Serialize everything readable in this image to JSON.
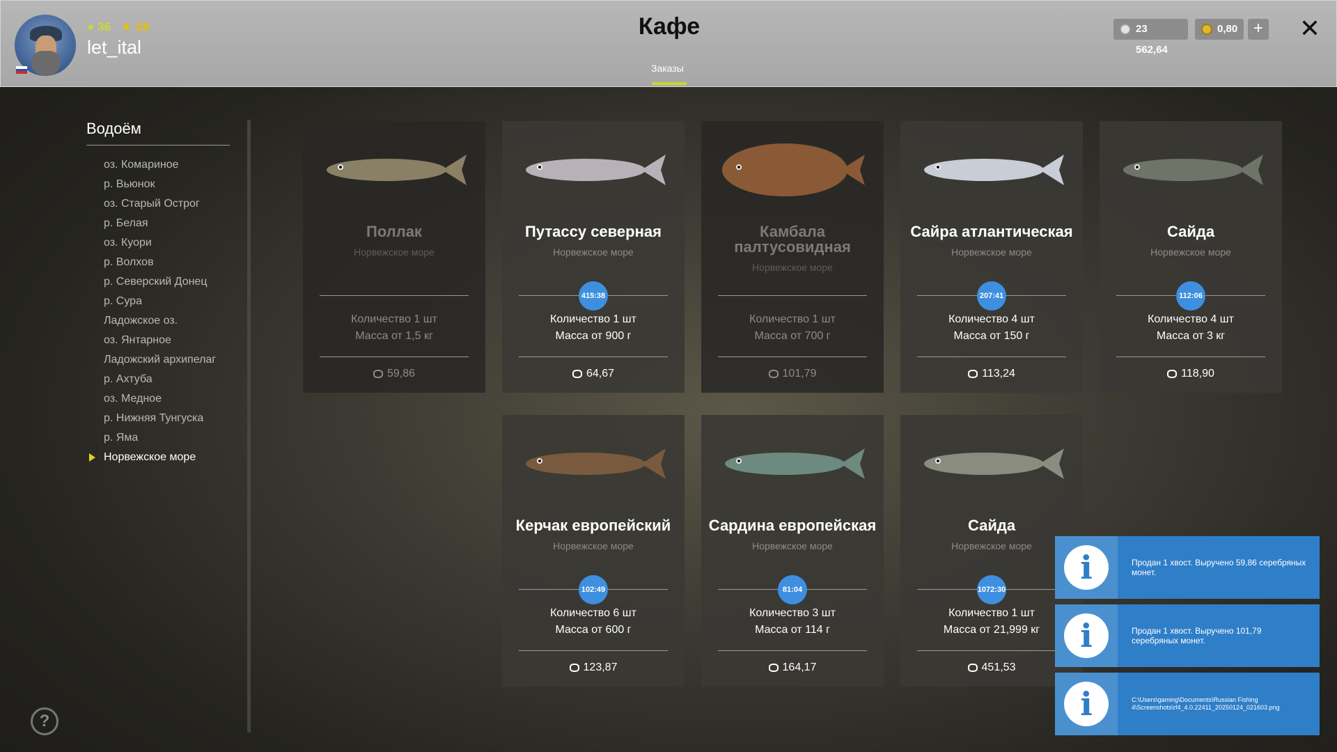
{
  "header": {
    "level": "36",
    "stars": "28",
    "username": "let_ital",
    "title": "Кафе",
    "tab": "Заказы",
    "silver": "23 562,64",
    "gold": "0,80",
    "plus": "+",
    "close": "✕"
  },
  "sidebar": {
    "title": "Водоём",
    "items": [
      {
        "label": "оз. Комариное"
      },
      {
        "label": "р. Вьюнок"
      },
      {
        "label": "оз. Старый Острог"
      },
      {
        "label": "р. Белая"
      },
      {
        "label": "оз. Куори"
      },
      {
        "label": "р. Волхов"
      },
      {
        "label": "р. Северский Донец"
      },
      {
        "label": "р. Сура"
      },
      {
        "label": "Ладожское оз."
      },
      {
        "label": "оз. Янтарное"
      },
      {
        "label": "Ладожский архипелаг"
      },
      {
        "label": "р. Ахтуба"
      },
      {
        "label": "оз. Медное"
      },
      {
        "label": "р. Нижняя Тунгуска"
      },
      {
        "label": "р. Яма"
      },
      {
        "label": "Норвежское море",
        "active": true
      }
    ]
  },
  "help": "?",
  "orders": [
    {
      "name": "Поллак",
      "location": "Норвежское море",
      "timer": "",
      "quantity": "Количество 1 шт",
      "mass": "Масса от 1,5 кг",
      "price": "59,86",
      "status": "disabled",
      "fish_color": "#8a8066"
    },
    {
      "name": "Путассу северная",
      "location": "Норвежское море",
      "timer": "415:38",
      "quantity": "Количество 1 шт",
      "mass": "Масса от 900 г",
      "price": "64,67",
      "status": "active",
      "fish_color": "#b8b2b8"
    },
    {
      "name": "Камбала палтусовидная",
      "location": "Норвежское море",
      "timer": "",
      "quantity": "Количество 1 шт",
      "mass": "Масса от 700 г",
      "price": "101,79",
      "status": "disabled",
      "fish_color": "#8a5a36"
    },
    {
      "name": "Сайра атлантическая",
      "location": "Норвежское море",
      "timer": "207:41",
      "quantity": "Количество 4 шт",
      "mass": "Масса от 150 г",
      "price": "113,24",
      "status": "active",
      "fish_color": "#c8cdd6"
    },
    {
      "name": "Сайда",
      "location": "Норвежское море",
      "timer": "112:06",
      "quantity": "Количество 4 шт",
      "mass": "Масса от 3 кг",
      "price": "118,90",
      "status": "active",
      "fish_color": "#6e7468"
    },
    {
      "name": "Керчак европейский",
      "location": "Норвежское море",
      "timer": "102:49",
      "quantity": "Количество 6 шт",
      "mass": "Масса от 600 г",
      "price": "123,87",
      "status": "active",
      "fish_color": "#7a5a3e"
    },
    {
      "name": "Сардина европейская",
      "location": "Норвежское море",
      "timer": "81:04",
      "quantity": "Количество 3 шт",
      "mass": "Масса от 114 г",
      "price": "164,17",
      "status": "active",
      "fish_color": "#6d8a80"
    },
    {
      "name": "Сайда",
      "location": "Норвежское море",
      "timer": "1072:30",
      "quantity": "Количество 1 шт",
      "mass": "Масса от 21,999 кг",
      "price": "451,53",
      "status": "active",
      "fish_color": "#8a8c80"
    }
  ],
  "notifications": [
    {
      "text": "Продан 1 хвост. Выручено 59,86 серебряных монет."
    },
    {
      "text": "Продан 1 хвост. Выручено 101,79 серебряных монет."
    },
    {
      "text": "C:\\Users\\gaming\\Documents\\Russian Fishing 4\\Screenshots\\rf4_4.0.22411_20250124_021603.png"
    }
  ],
  "colors": {
    "accent_yellow": "#c8d630",
    "timer_blue": "#3f8fe0",
    "notification_blue": "#2f7ec8"
  }
}
